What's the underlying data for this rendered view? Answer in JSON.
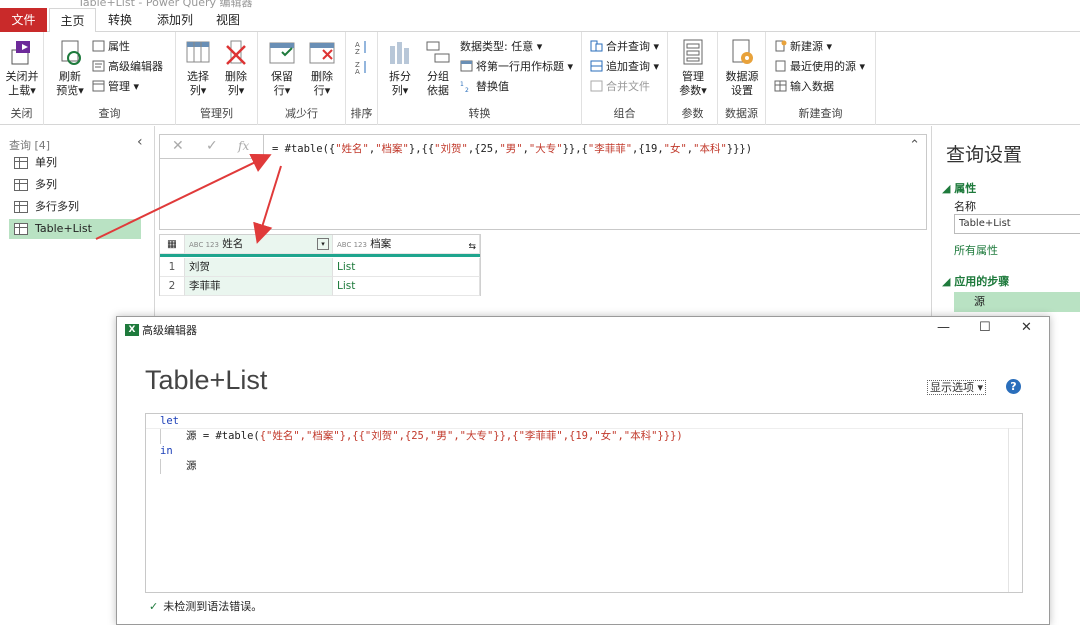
{
  "window": {
    "title": "Table+List - Power Query 编辑器"
  },
  "tabs": [
    "文件",
    "主页",
    "转换",
    "添加列",
    "视图"
  ],
  "ribbon": {
    "close": {
      "btn": [
        "关闭并",
        "上载▾"
      ],
      "label": "关闭"
    },
    "query": {
      "refresh": [
        "刷新",
        "预览▾"
      ],
      "properties": "属性",
      "advanced_editor": "高级编辑器",
      "manage": "管理 ▾",
      "label": "查询"
    },
    "manage_columns": {
      "choose": [
        "选择",
        "列▾"
      ],
      "remove": [
        "删除",
        "列▾"
      ],
      "label": "管理列"
    },
    "reduce_rows": {
      "keep": [
        "保留",
        "行▾"
      ],
      "remove": [
        "删除",
        "行▾"
      ],
      "label": "减少行"
    },
    "sort": {
      "label": "排序"
    },
    "transform": {
      "split": [
        "拆分",
        "列▾"
      ],
      "group": [
        "分组",
        "依据"
      ],
      "data_type": "数据类型: 任意 ▾",
      "first_row": "将第一行用作标题 ▾",
      "replace": "替换值",
      "label": "转换"
    },
    "combine": {
      "merge": "合并查询 ▾",
      "append": "追加查询 ▾",
      "combine_files": "合并文件",
      "label": "组合"
    },
    "params": {
      "manage": [
        "管理",
        "参数▾"
      ],
      "label": "参数"
    },
    "datasource": {
      "settings": [
        "数据源",
        "设置"
      ],
      "label": "数据源"
    },
    "new_query": {
      "new_source": "新建源 ▾",
      "recent": "最近使用的源 ▾",
      "enter": "输入数据",
      "label": "新建查询"
    }
  },
  "queries": {
    "header": "查询 [4]",
    "items": [
      "单列",
      "多列",
      "多行多列",
      "Table+List"
    ],
    "selected": 3
  },
  "formula": {
    "prefix": "= #table(",
    "parts": [
      [
        "{",
        ""
      ],
      [
        "\"姓名\"",
        "s"
      ],
      [
        ",",
        ""
      ],
      [
        "\"档案\"",
        "s"
      ],
      [
        "},{{",
        ""
      ],
      [
        "\"刘贺\"",
        "s"
      ],
      [
        ",{25,",
        ""
      ],
      [
        "\"男\"",
        "s"
      ],
      [
        ",",
        ""
      ],
      [
        "\"大专\"",
        "s"
      ],
      [
        "}},{",
        ""
      ],
      [
        "\"李菲菲\"",
        "s"
      ],
      [
        ",{19,",
        ""
      ],
      [
        "\"女\"",
        "s"
      ],
      [
        ",",
        ""
      ],
      [
        "\"本科\"",
        "s"
      ],
      [
        "}}})",
        ""
      ]
    ]
  },
  "grid": {
    "columns": [
      {
        "type": "ABC 123",
        "name": "姓名"
      },
      {
        "type": "ABC 123",
        "name": "档案"
      }
    ],
    "rows": [
      [
        "1",
        "刘贺",
        "List"
      ],
      [
        "2",
        "李菲菲",
        "List"
      ]
    ]
  },
  "settings": {
    "title": "查询设置",
    "props": "属性",
    "name_label": "名称",
    "name_value": "Table+List",
    "all_props": "所有属性",
    "steps": "应用的步骤",
    "step1": "源"
  },
  "dialog": {
    "title": "高级编辑器",
    "heading": "Table+List",
    "options": "显示选项 ▾",
    "help": "?",
    "code": {
      "l1": "let",
      "l2a": "源 = #table(",
      "l2b": "{\"姓名\",\"档案\"},{{\"刘贺\",{25,\"男\",\"大专\"}},{\"李菲菲\",{19,\"女\",\"本科\"}}})",
      "l3": "in",
      "l4": "源"
    },
    "status": "未检测到语法错误。",
    "status_icon": "✓"
  }
}
